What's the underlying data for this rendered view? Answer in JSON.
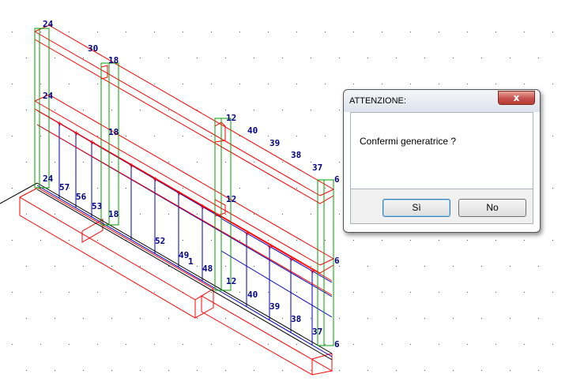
{
  "dialog": {
    "title": "ATTENZIONE:",
    "close_glyph": "x",
    "message": "Confermi generatrice ?",
    "yes_label": "Sì",
    "no_label": "No"
  },
  "drawing": {
    "labels": [
      "24",
      "30",
      "18",
      "24",
      "12",
      "40",
      "39",
      "38",
      "37",
      "6",
      "18",
      "24",
      "57",
      "56",
      "53",
      "18",
      "52",
      "49",
      "1",
      "48",
      "12",
      "6",
      "12",
      "40",
      "39",
      "38",
      "37",
      "6"
    ],
    "colors": {
      "frame": "#ff0000",
      "posts": "#00a000",
      "bars": "#0000c0",
      "text": "#000080"
    }
  }
}
